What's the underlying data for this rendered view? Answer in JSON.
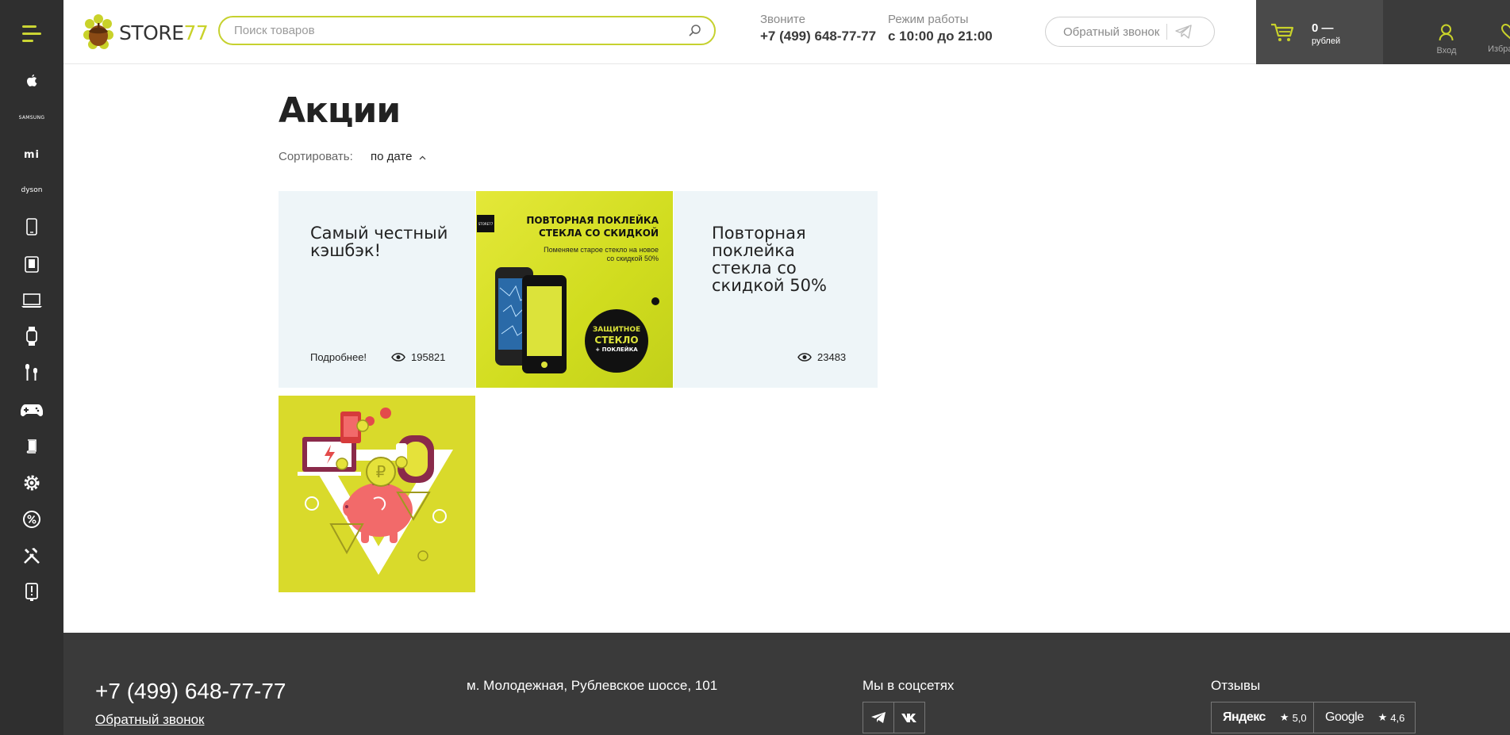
{
  "sidebar": {
    "items": [
      {
        "name": "apple-icon"
      },
      {
        "label": "SAMSUNG"
      },
      {
        "label": "mi"
      },
      {
        "label": "dyson"
      },
      {
        "name": "smartphone-icon"
      },
      {
        "name": "tablet-icon"
      },
      {
        "name": "laptop-icon"
      },
      {
        "name": "smartwatch-icon"
      },
      {
        "name": "headphones-icon"
      },
      {
        "name": "gamepad-icon"
      },
      {
        "name": "book-icon"
      },
      {
        "name": "gear-icon"
      },
      {
        "name": "percent-icon"
      },
      {
        "name": "tools-icon"
      },
      {
        "name": "info-tablet-icon"
      }
    ]
  },
  "header": {
    "logo": {
      "text": "STORE",
      "number": "77"
    },
    "search": {
      "placeholder": "Поиск товаров"
    },
    "call": {
      "caption": "Звоните",
      "phone": "+7 (499) 648-77-77"
    },
    "hours": {
      "caption": "Режим работы",
      "value": "с 10:00 до 21:00"
    },
    "callback_label": "Обратный звонок",
    "cart": {
      "sum": "0 —",
      "currency": "рублей"
    },
    "login_label": "Вход",
    "favorites_label": "Избранное"
  },
  "main": {
    "title": "Акции",
    "sort": {
      "label": "Сортировать:",
      "value": "по дате"
    },
    "cards": [
      {
        "title": "Самый честный кэшбэк!",
        "more": "Подробнее!",
        "views": "195821"
      },
      {
        "title": "Повторная поклейка стекла со скидкой 50%",
        "views": "23483"
      }
    ],
    "banner_glass": {
      "line1": "ПОВТОРНАЯ ПОКЛЕЙКА",
      "line2": "СТЕКЛА СО СКИДКОЙ",
      "sub1": "Поменяем старое стекло на новое",
      "sub2": "со скидкой 50%",
      "circle1": "ЗАЩИТНОЕ",
      "circle2": "СТЕКЛО",
      "circle3": "+ ПОКЛЕЙКА",
      "badge": "STORE77"
    }
  },
  "footer": {
    "phone": "+7 (499) 648-77-77",
    "callback": "Обратный звонок",
    "address": "м. Молодежная, Рублевское шоссе, 101",
    "social_title": "Мы в соцсетях",
    "reviews_title": "Отзывы",
    "reviews": [
      {
        "name": "Яндекс",
        "score": "5,0"
      },
      {
        "name": "Google",
        "score": "4,6"
      }
    ]
  },
  "colors": {
    "accent": "#c6d12f",
    "sidebar": "#2f2f2f",
    "footer": "#3a3a3a",
    "card_bg": "#eef5f8"
  }
}
